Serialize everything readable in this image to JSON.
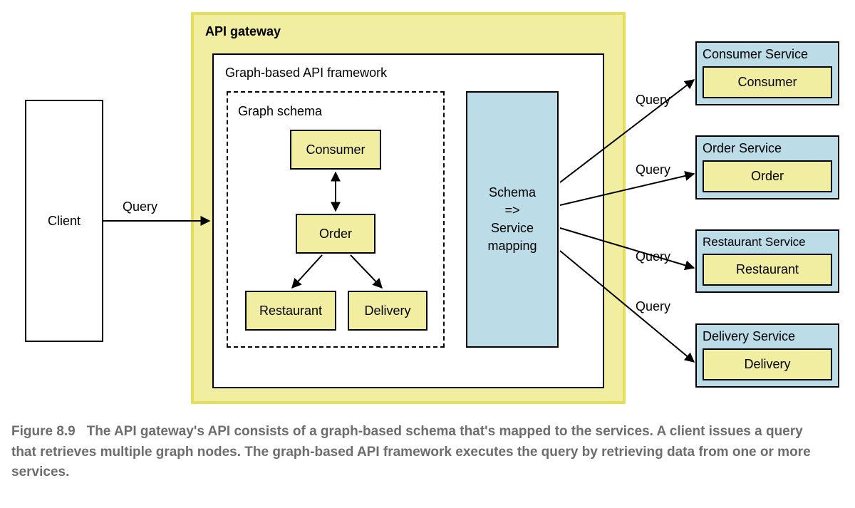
{
  "client": {
    "label": "Client"
  },
  "api_gateway": {
    "title": "API gateway"
  },
  "framework": {
    "title": "Graph-based API framework"
  },
  "schema": {
    "title": "Graph schema",
    "nodes": {
      "consumer": "Consumer",
      "order": "Order",
      "restaurant": "Restaurant",
      "delivery": "Delivery"
    }
  },
  "mapping": {
    "line1": "Schema",
    "line2": "=>",
    "line3": "Service",
    "line4": "mapping"
  },
  "edges": {
    "client_query": "Query",
    "q1": "Query",
    "q2": "Query",
    "q3": "Query",
    "q4": "Query"
  },
  "services": {
    "consumer": {
      "title": "Consumer Service",
      "inner": "Consumer"
    },
    "order": {
      "title": "Order Service",
      "inner": "Order"
    },
    "restaurant": {
      "title": "Restaurant Service",
      "inner": "Restaurant"
    },
    "delivery": {
      "title": "Delivery Service",
      "inner": "Delivery"
    }
  },
  "caption": {
    "figno": "Figure 8.9",
    "text": "The API gateway's API consists of a graph-based schema that's mapped to the services. A client issues a query that retrieves multiple graph nodes. The graph-based API framework executes the query by retrieving data from one or more services."
  }
}
